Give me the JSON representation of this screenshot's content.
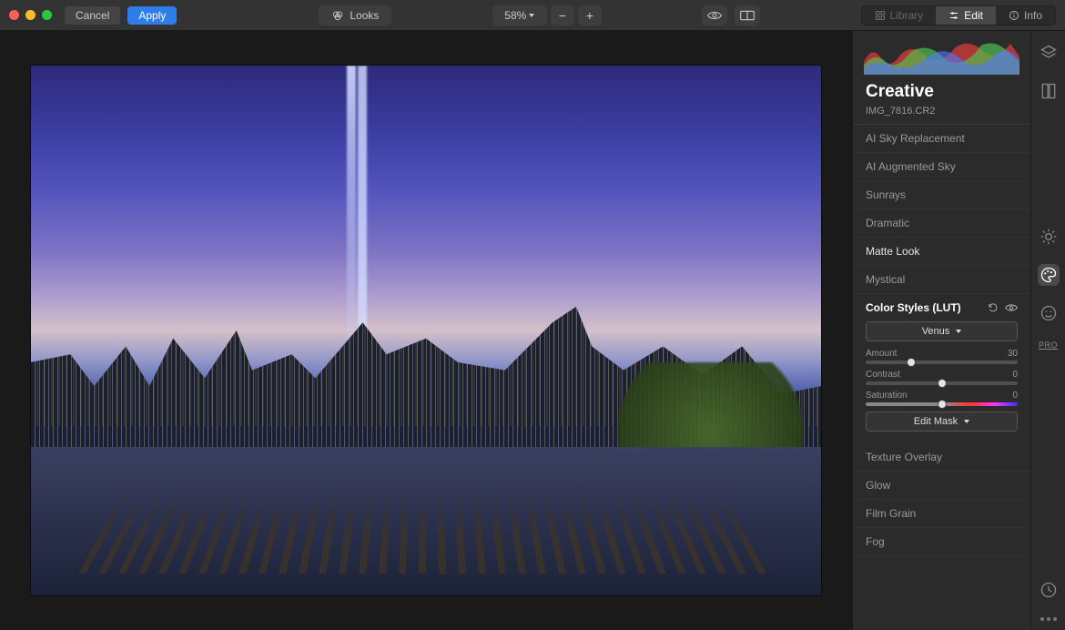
{
  "toolbar": {
    "cancel": "Cancel",
    "apply": "Apply",
    "looks": "Looks",
    "zoom": "58%"
  },
  "view_modes": {
    "library": "Library",
    "edit": "Edit",
    "info": "Info"
  },
  "panel": {
    "title": "Creative",
    "filename": "IMG_7816.CR2",
    "items_top": [
      "AI Sky Replacement",
      "AI Augmented Sky",
      "Sunrays",
      "Dramatic",
      "Matte Look",
      "Mystical"
    ],
    "items_bottom": [
      "Texture Overlay",
      "Glow",
      "Film Grain",
      "Fog"
    ]
  },
  "lut": {
    "title": "Color Styles (LUT)",
    "preset": "Venus",
    "mask": "Edit Mask",
    "sliders": {
      "amount": {
        "label": "Amount",
        "value": "30",
        "pos": 30
      },
      "contrast": {
        "label": "Contrast",
        "value": "0",
        "pos": 50
      },
      "saturation": {
        "label": "Saturation",
        "value": "0",
        "pos": 50
      }
    }
  },
  "rail": {
    "pro": "PRO"
  }
}
